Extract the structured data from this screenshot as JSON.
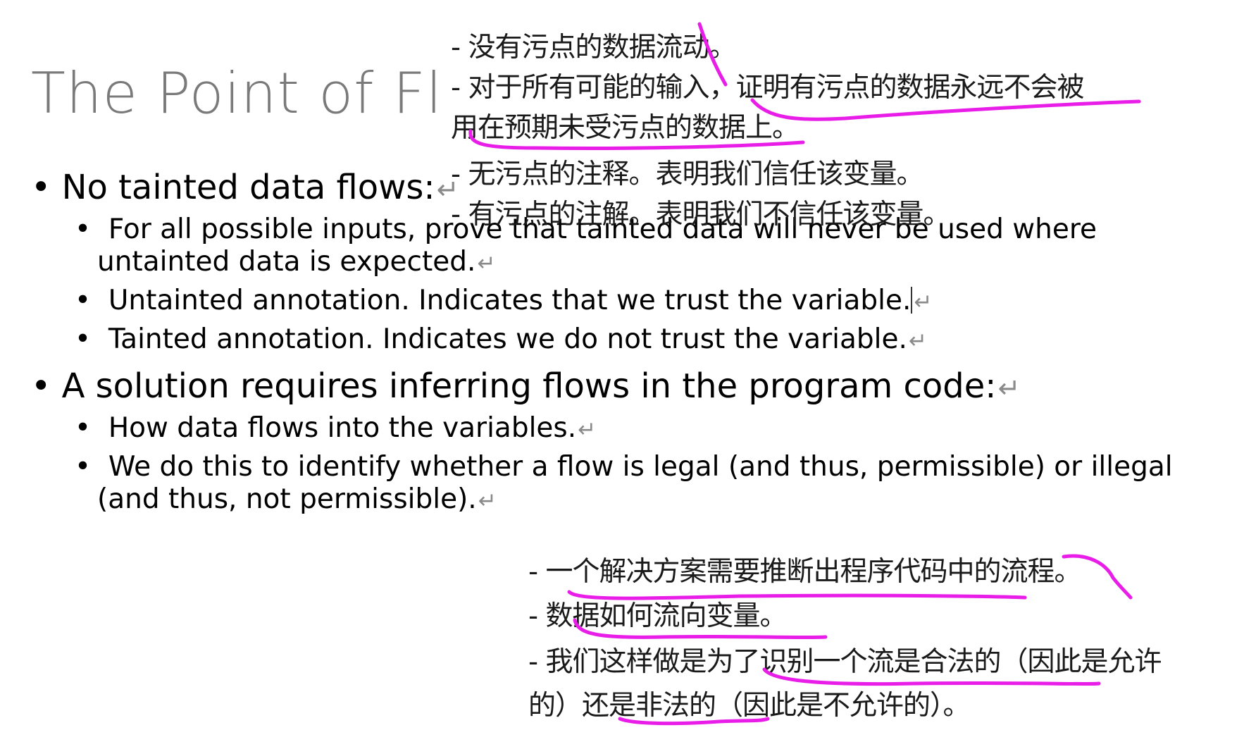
{
  "slide": {
    "title": "The Point of Flow",
    "return_mark": "↵",
    "bullets": [
      {
        "text": "No tainted data flows:",
        "sub": [
          {
            "line1": "For all possible inputs, prove that tainted data will never be used where",
            "line2": "untainted data is expected."
          },
          {
            "line1": "Untainted annotation. Indicates that we trust the variable."
          },
          {
            "line1": "Tainted annotation. Indicates we do not trust the variable."
          }
        ]
      },
      {
        "text": "A solution requires inferring flows in the program code:",
        "sub": [
          {
            "line1": "How data flows into the variables."
          },
          {
            "line1": "We do this to identify whether a flow is legal (and thus, permissible) or illegal",
            "line2": "(and thus, not permissible)."
          }
        ]
      }
    ]
  },
  "translation_top": {
    "lines": [
      "- 没有污点的数据流动。",
      "- 对于所有可能的输入，证明有污点的数据永远不会被",
      "用在预期未受污点的数据上。",
      "- 无污点的注释。表明我们信任该变量。",
      "- 有污点的注解。表明我们不信任该变量。"
    ]
  },
  "translation_bottom": {
    "lines": [
      "- 一个解决方案需要推断出程序代码中的流程。",
      "- 数据如何流向变量。",
      "- 我们这样做是为了识别一个流是合法的（因此是允许",
      "的）还是非法的（因此是不允许的）。"
    ]
  },
  "colors": {
    "title": "#7a7a7a",
    "annotation_ink": "#e81ee8",
    "text": "#000000"
  }
}
